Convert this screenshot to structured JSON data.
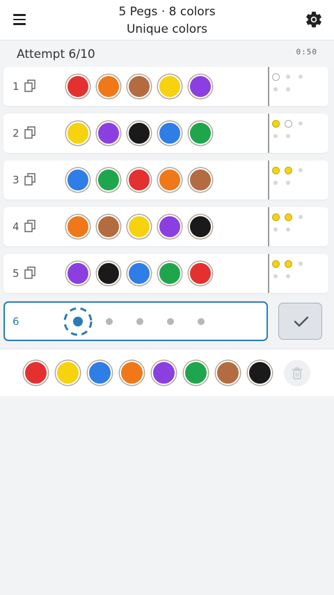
{
  "header": {
    "title_line1": "5 Pegs · 8 colors",
    "title_line2": "Unique colors",
    "menu_icon": "hamburger-menu-icon",
    "settings_icon": "gear-icon"
  },
  "status": {
    "attempt": "Attempt 6/10",
    "timer": "0:50"
  },
  "colors": {
    "red": "#e53030",
    "orange": "#f07818",
    "brown": "#b36b40",
    "yellow": "#f7d20e",
    "purple": "#8b3fe0",
    "black": "#1a1a1a",
    "blue": "#2f7de6",
    "green": "#1fa64d"
  },
  "guesses": [
    {
      "number": "1",
      "pegs": [
        "red",
        "orange",
        "brown",
        "yellow",
        "purple"
      ],
      "feedback": {
        "black": 0,
        "white": 1
      }
    },
    {
      "number": "2",
      "pegs": [
        "yellow",
        "purple",
        "black",
        "blue",
        "green"
      ],
      "feedback": {
        "black": 1,
        "white": 1
      }
    },
    {
      "number": "3",
      "pegs": [
        "blue",
        "green",
        "red",
        "orange",
        "brown"
      ],
      "feedback": {
        "black": 2,
        "white": 0
      }
    },
    {
      "number": "4",
      "pegs": [
        "orange",
        "brown",
        "yellow",
        "purple",
        "black"
      ],
      "feedback": {
        "black": 2,
        "white": 0
      }
    },
    {
      "number": "5",
      "pegs": [
        "purple",
        "black",
        "blue",
        "green",
        "red"
      ],
      "feedback": {
        "black": 2,
        "white": 0
      }
    }
  ],
  "current": {
    "number": "6",
    "selected_slot": 1,
    "slots": 5
  },
  "palette": [
    "red",
    "yellow",
    "blue",
    "orange",
    "purple",
    "green",
    "brown",
    "black"
  ],
  "icons": {
    "copy": "copy-icon",
    "submit": "checkmark-icon",
    "trash": "trash-icon"
  }
}
